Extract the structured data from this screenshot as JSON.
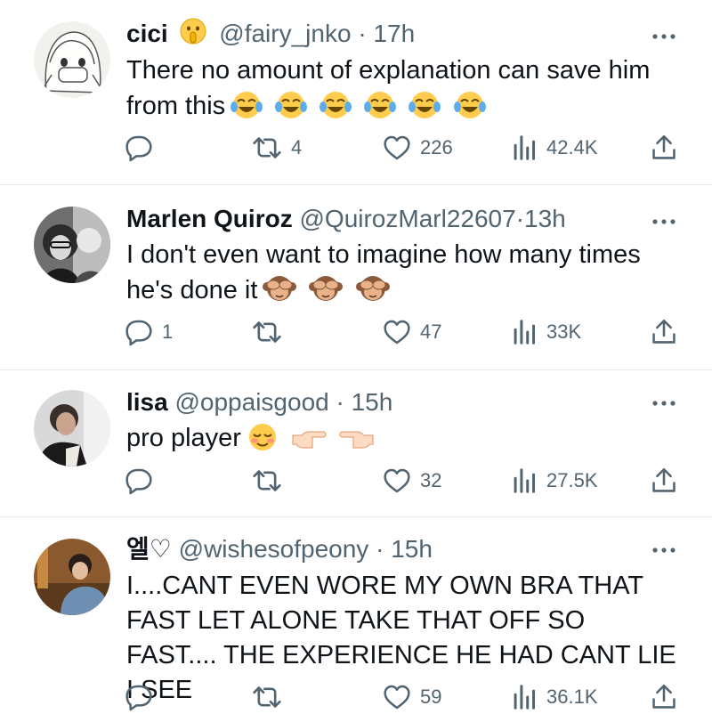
{
  "tweets": [
    {
      "name": "cici",
      "name_emoji": "shushing-face-emoji",
      "handle": "@fairy_jnko",
      "dot": "·",
      "time": "17h",
      "text": "There no amount of explanation can save him from this",
      "emojis": [
        "joy",
        "joy",
        "joy",
        "joy",
        "joy",
        "joy"
      ],
      "replies": "",
      "retweets": "4",
      "likes": "226",
      "views": "42.4K"
    },
    {
      "name": "Marlen Quiroz",
      "handle": "@QuirozMarl22607",
      "dot": "·",
      "time": "13h",
      "text": "I don't even want to imagine how many times he's done it",
      "emojis": [
        "see-no-evil",
        "see-no-evil",
        "see-no-evil"
      ],
      "replies": "1",
      "retweets": "",
      "likes": "47",
      "views": "33K"
    },
    {
      "name": "lisa",
      "handle": "@oppaisgood",
      "dot": "·",
      "time": "15h",
      "text": "pro player",
      "emojis": [
        "relieved",
        "point-right",
        "point-left"
      ],
      "replies": "",
      "retweets": "",
      "likes": "32",
      "views": "27.5K"
    },
    {
      "name": "엘♡",
      "handle": "@wishesofpeony",
      "dot": "·",
      "time": "15h",
      "text": "I....CANT EVEN WORE MY OWN BRA THAT FAST LET ALONE TAKE THAT OFF SO FAST.... THE EXPERIENCE HE HAD CANT LIE I SEE",
      "emojis": [],
      "replies": "",
      "retweets": "",
      "likes": "59",
      "views": "36.1K"
    }
  ],
  "colors": {
    "text": "#0f1419",
    "secondary": "#536471",
    "divider": "#e6ecf0"
  },
  "icons": [
    "reply-icon",
    "retweet-icon",
    "like-icon",
    "views-icon",
    "share-icon",
    "more-icon"
  ]
}
